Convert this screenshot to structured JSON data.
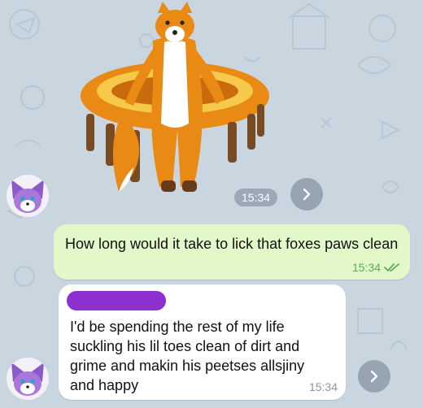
{
  "messages": {
    "sticker": {
      "time": "15:34",
      "subject": "fox-sticker"
    },
    "outgoing": {
      "text": "How long would it take to lick that foxes paws clean",
      "time": "15:34",
      "status": "read"
    },
    "incoming": {
      "text": "I'd be spending the rest of my life suckling his lil toes clean of dirt and grime and makin his peetses allsjiny and happy",
      "time": "15:34"
    }
  },
  "colors": {
    "wallpaper": "#c9d6e0",
    "outgoing_bubble": "#e3f8c8",
    "incoming_bubble": "#ffffff",
    "check_marks": "#5ea85a",
    "sender_redaction": "#8e2fd0"
  },
  "icons": {
    "share": "chevron-right-icon",
    "read_receipt": "double-check-icon",
    "avatar": "purple-fox-avatar"
  }
}
